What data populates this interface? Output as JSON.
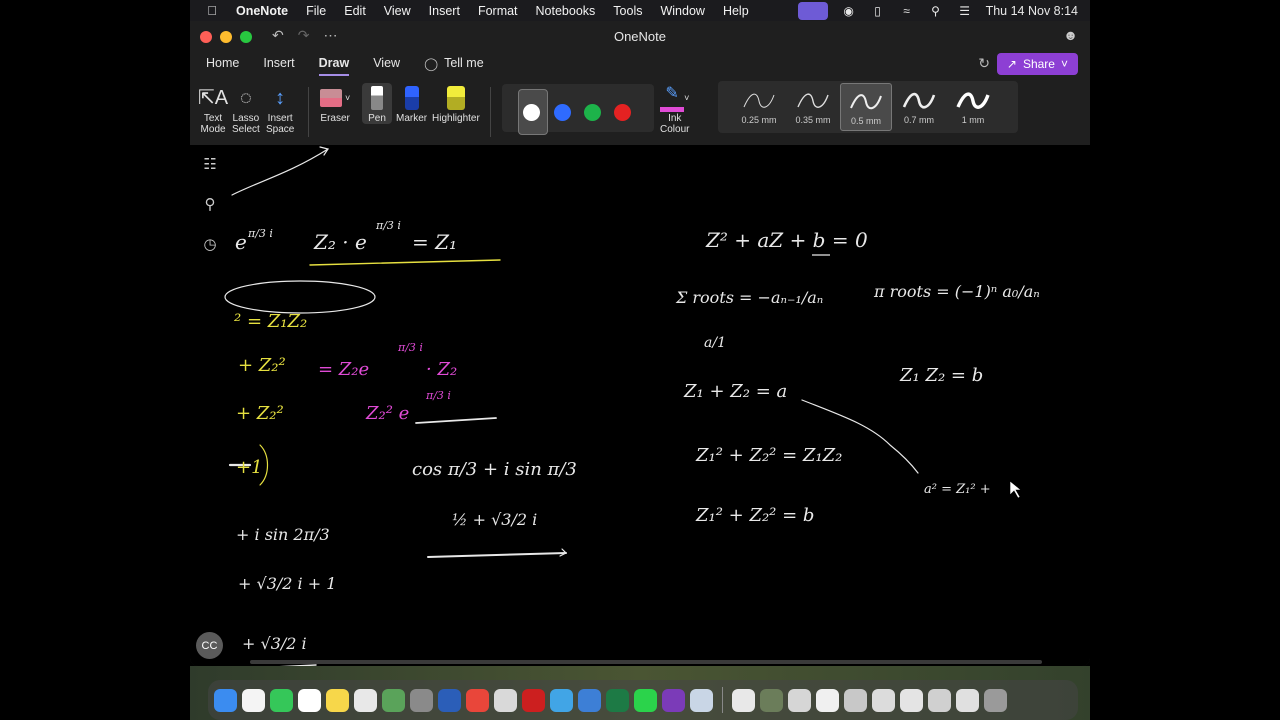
{
  "menubar": {
    "app_name": "OneNote",
    "items": [
      "File",
      "Edit",
      "View",
      "Insert",
      "Format",
      "Notebooks",
      "Tools",
      "Window",
      "Help"
    ],
    "clock": "Thu 14 Nov  8:14"
  },
  "window": {
    "title": "OneNote",
    "tabs": [
      "Home",
      "Insert",
      "Draw",
      "View"
    ],
    "tell_me": "Tell me",
    "share_label": "Share"
  },
  "ribbon": {
    "tools": {
      "text_mode": "Text\nMode",
      "lasso_select": "Lasso\nSelect",
      "insert_space": "Insert\nSpace",
      "eraser": "Eraser",
      "pen": "Pen",
      "marker": "Marker",
      "highlighter": "Highlighter",
      "ink_colour": "Ink\nColour"
    },
    "colors": {
      "white": "#ffffff",
      "blue": "#2f6bff",
      "green": "#1db34a",
      "red": "#e52222"
    },
    "pen_widths": [
      "0.25 mm",
      "0.35 mm",
      "0.5 mm",
      "0.7 mm",
      "1 mm"
    ],
    "selected_width": "0.5 mm"
  },
  "canvas": {
    "cc_badge": "CC",
    "ink_colors": {
      "white": "#e8e8e8",
      "magenta": "#e04bd6",
      "yellow": "#e6e040"
    }
  }
}
